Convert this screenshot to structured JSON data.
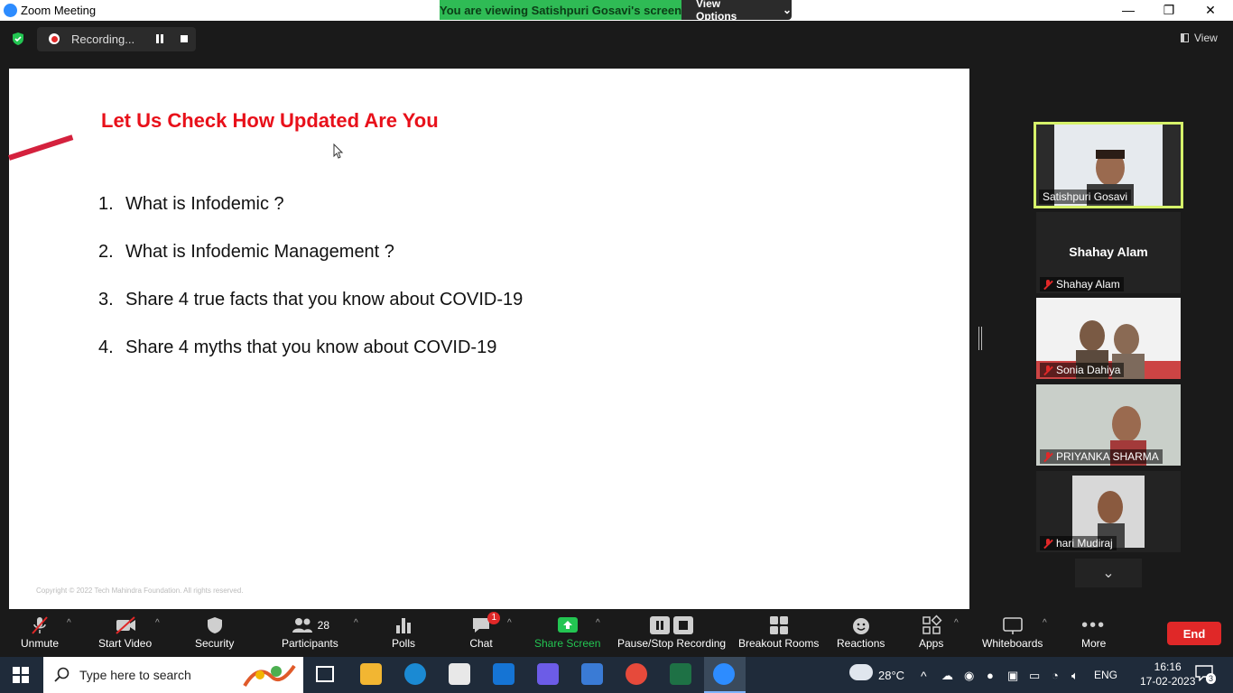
{
  "titlebar": {
    "app_title": "Zoom Meeting"
  },
  "share_banner": {
    "message": "You are viewing Satishpuri Gosavi's screen",
    "options": "View Options"
  },
  "recording": {
    "label": "Recording..."
  },
  "view": {
    "label": "View"
  },
  "slide": {
    "title": "Let Us Check How Updated Are You",
    "questions": [
      {
        "num": "1.",
        "text": "What is Infodemic ?"
      },
      {
        "num": "2.",
        "text": "What is Infodemic Management ?"
      },
      {
        "num": "3.",
        "text": "Share 4 true facts that you know about COVID-19"
      },
      {
        "num": "4.",
        "text": "Share 4 myths that you know about COVID-19"
      }
    ],
    "copyright": "Copyright © 2022 Tech Mahindra Foundation. All rights reserved."
  },
  "participants_panel": {
    "tiles": [
      {
        "name": "Satishpuri Gosavi"
      },
      {
        "name": "Shahay Alam",
        "center_name": "Shahay Alam"
      },
      {
        "name": "Sonia Dahiya"
      },
      {
        "name": "PRIYANKA SHARMA"
      },
      {
        "name": "hari Mudiraj"
      }
    ]
  },
  "toolbar": {
    "unmute": "Unmute",
    "start_video": "Start Video",
    "security": "Security",
    "participants": "Participants",
    "participants_count": "28",
    "polls": "Polls",
    "chat": "Chat",
    "chat_badge": "1",
    "share_screen": "Share Screen",
    "pause_stop_recording": "Pause/Stop Recording",
    "breakout_rooms": "Breakout Rooms",
    "reactions": "Reactions",
    "apps": "Apps",
    "whiteboards": "Whiteboards",
    "more": "More",
    "end": "End"
  },
  "taskbar": {
    "search_placeholder": "Type here to search",
    "temperature": "28°C",
    "language": "ENG",
    "time": "16:16",
    "date": "17-02-2023",
    "notifications": "3"
  },
  "colors": {
    "accent_green": "#2fbb55",
    "end_red": "#e02828",
    "slide_title_red": "#e8101a",
    "active_speaker": "#d6f26a"
  }
}
